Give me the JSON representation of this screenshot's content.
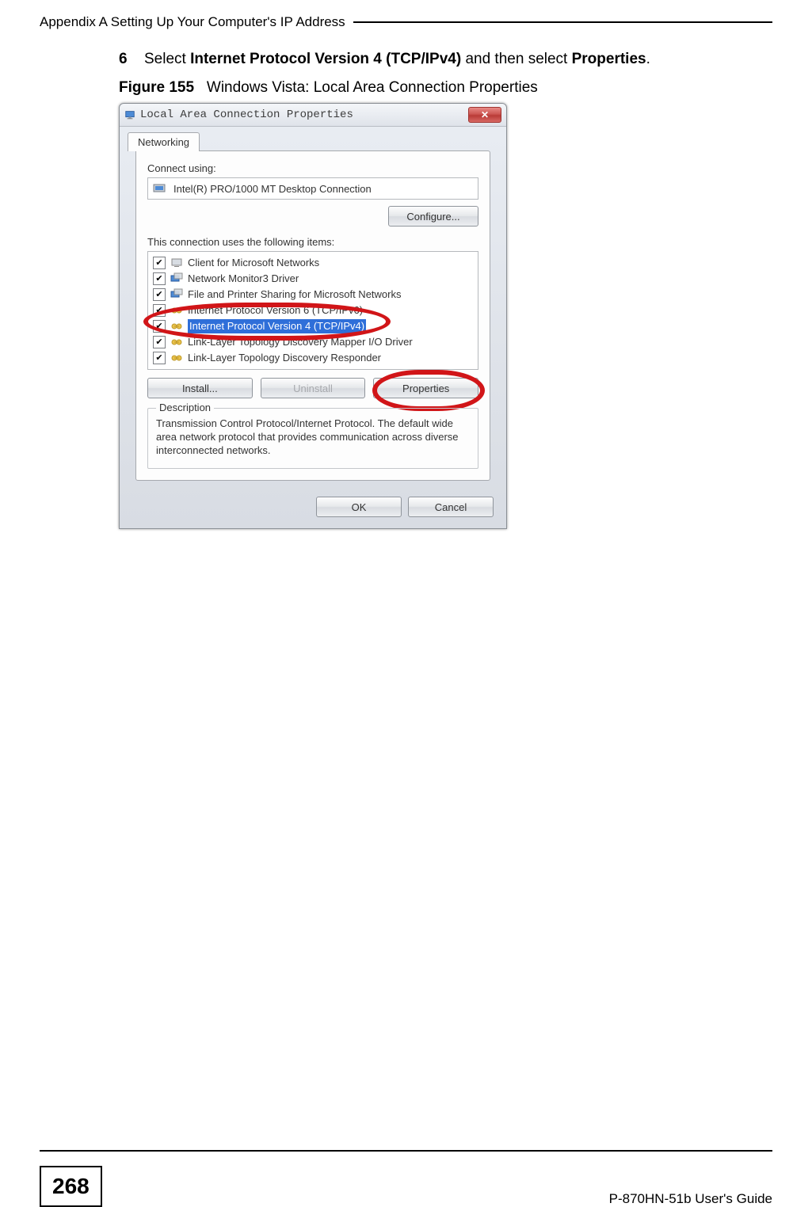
{
  "header": {
    "appendix_title": "Appendix A Setting Up Your Computer's IP Address"
  },
  "step": {
    "number": "6",
    "prefix": "Select ",
    "bold1": "Internet Protocol Version 4 (TCP/IPv4)",
    "mid": " and then select ",
    "bold2": "Properties",
    "suffix": "."
  },
  "figure": {
    "label": "Figure 155",
    "caption": "Windows Vista: Local Area Connection Properties"
  },
  "dialog": {
    "title": "Local Area Connection Properties",
    "tab": "Networking",
    "connect_label": "Connect using:",
    "adapter": "Intel(R) PRO/1000 MT Desktop Connection",
    "configure_btn": "Configure...",
    "items_label": "This connection uses the following items:",
    "items": [
      "Client for Microsoft Networks",
      "Network Monitor3 Driver",
      "File and Printer Sharing for Microsoft Networks",
      "Internet Protocol Version 6 (TCP/IPv6)",
      "Internet Protocol Version 4 (TCP/IPv4)",
      "Link-Layer Topology Discovery Mapper I/O Driver",
      "Link-Layer Topology Discovery Responder"
    ],
    "install_btn": "Install...",
    "uninstall_btn": "Uninstall",
    "properties_btn": "Properties",
    "desc_legend": "Description",
    "desc_text": "Transmission Control Protocol/Internet Protocol. The default wide area network protocol that provides communication across diverse interconnected networks.",
    "ok_btn": "OK",
    "cancel_btn": "Cancel"
  },
  "footer": {
    "page_number": "268",
    "guide": "P-870HN-51b User's Guide"
  }
}
